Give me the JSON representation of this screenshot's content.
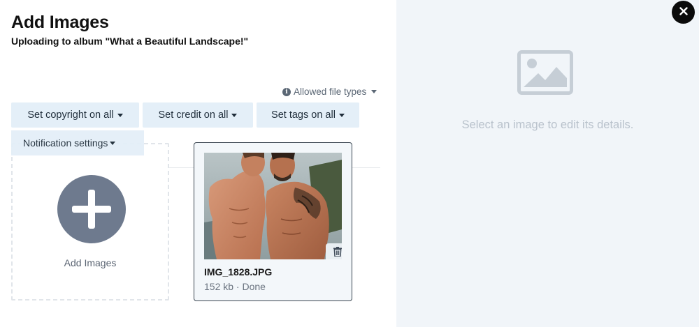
{
  "header": {
    "title": "Add Images",
    "subtitle": "Uploading to album \"What a Beautiful Landscape!\""
  },
  "allowed_file_types": {
    "label": "Allowed file types",
    "icon": "info-icon"
  },
  "toolbar": {
    "copyright_label": "Set copyright on all",
    "credit_label": "Set credit on all",
    "tags_label": "Set tags on all",
    "notification_label": "Notification settings"
  },
  "add_images": {
    "label": "Add Images",
    "icon": "plus-circle-icon"
  },
  "uploads": [
    {
      "file_name": "IMG_1828.JPG",
      "status": "152 kb · Done"
    }
  ],
  "details_panel": {
    "empty_text": "Select an image to edit its details.",
    "icon": "image-placeholder-icon"
  },
  "close": {
    "icon": "close-icon"
  },
  "colors": {
    "button_bg": "#e4eff8",
    "panel_bg": "#f1f5f9",
    "plus_circle": "#6e7a8e",
    "muted_text": "#b9c2cc"
  }
}
